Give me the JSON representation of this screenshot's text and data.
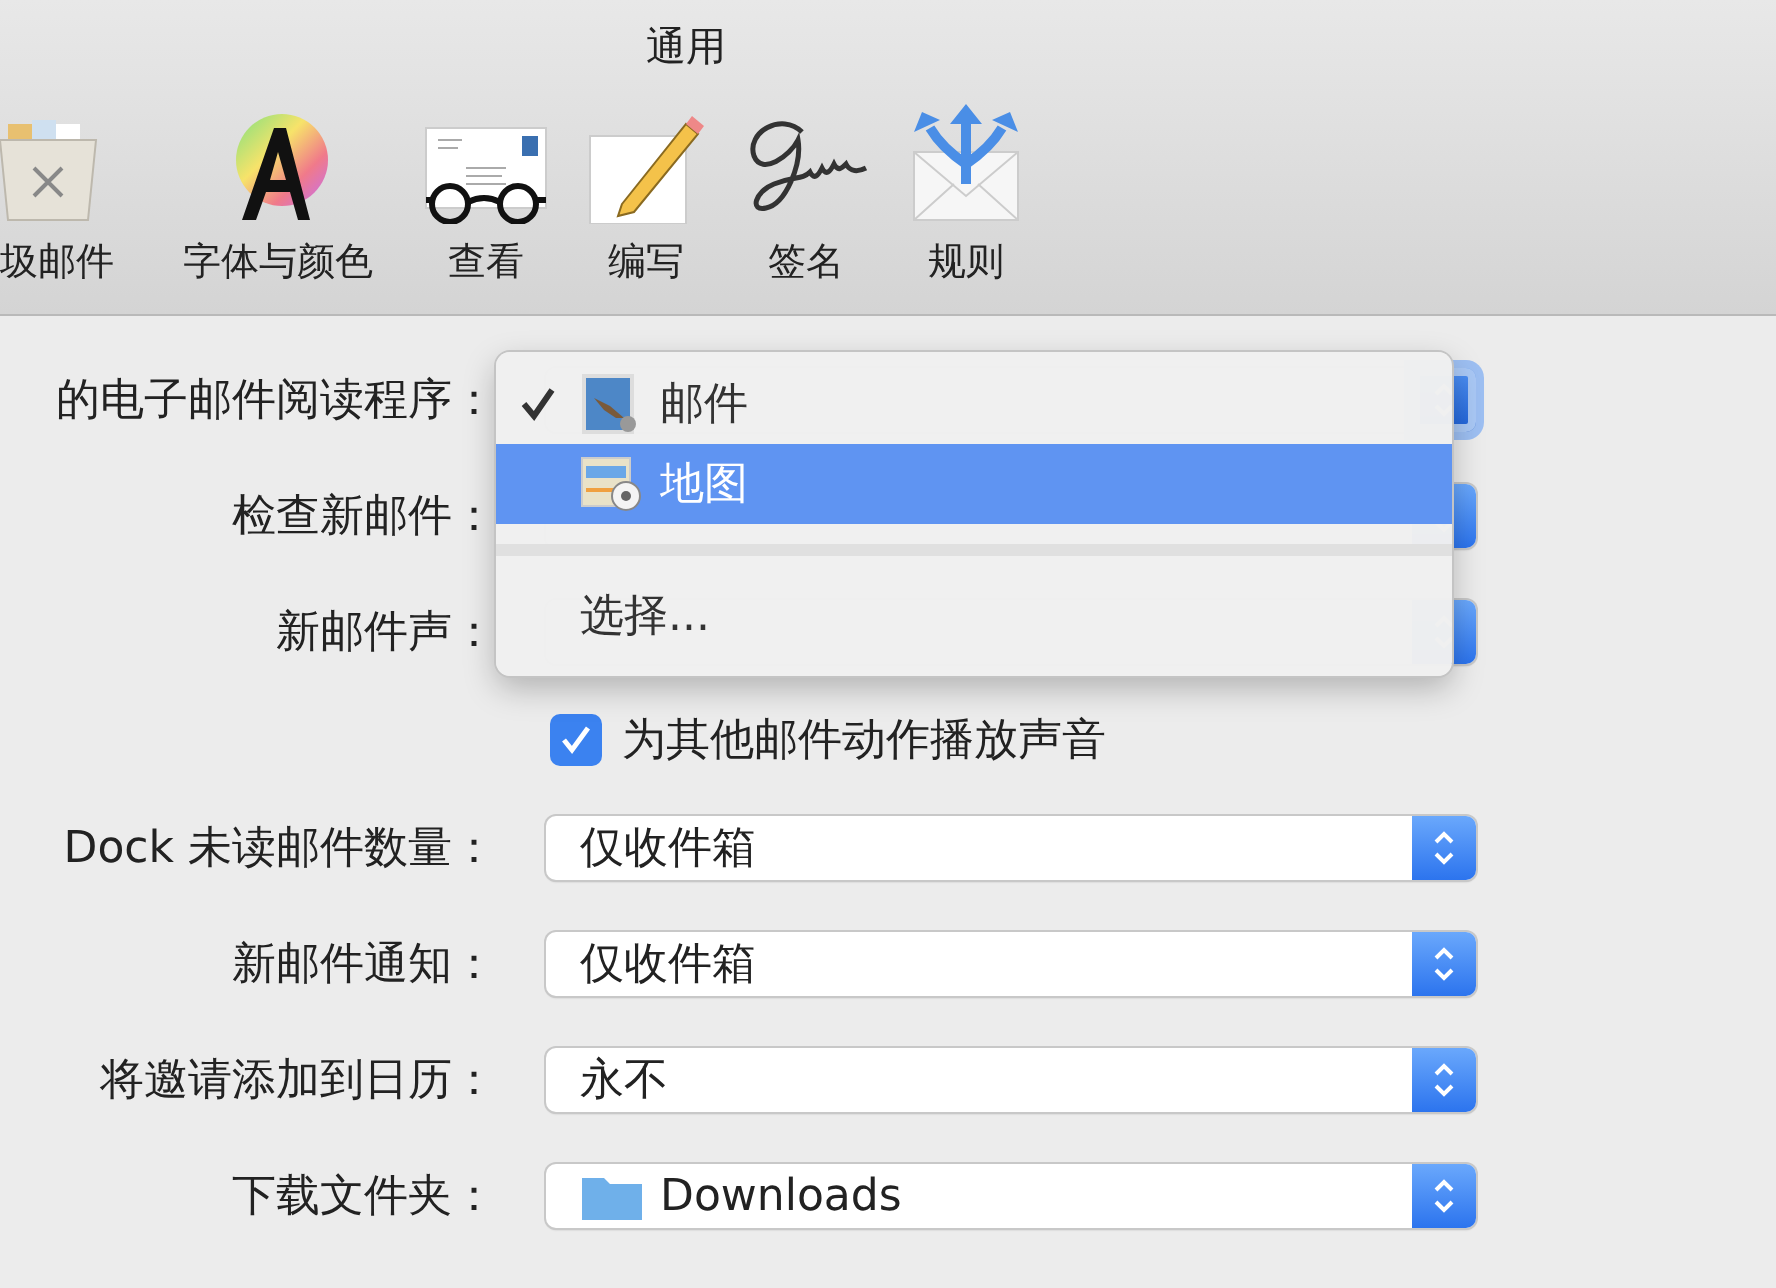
{
  "window": {
    "title": "通用"
  },
  "toolbar": [
    {
      "label": "圾邮件"
    },
    {
      "label": "字体与颜色"
    },
    {
      "label": "查看"
    },
    {
      "label": "编写"
    },
    {
      "label": "签名"
    },
    {
      "label": "规则"
    }
  ],
  "form": {
    "rows": [
      {
        "kind": "popup",
        "label": "的电子邮件阅读程序：",
        "focused": true
      },
      {
        "kind": "popup",
        "label": "检查新邮件：",
        "focused": false
      },
      {
        "kind": "popup",
        "label": "新邮件声：",
        "focused": false
      },
      {
        "kind": "checkbox",
        "label": "为其他邮件动作播放声音",
        "checked": true
      },
      {
        "kind": "popup",
        "label": "Dock 未读邮件数量：",
        "value": "仅收件箱",
        "focused": false
      },
      {
        "kind": "popup",
        "label": "新邮件通知：",
        "value": "仅收件箱",
        "focused": false
      },
      {
        "kind": "popup",
        "label": "将邀请添加到日历：",
        "value": "永不",
        "focused": false
      },
      {
        "kind": "folder",
        "label": "下载文件夹：",
        "value": "Downloads",
        "focused": false
      }
    ]
  },
  "menu": {
    "items": [
      {
        "kind": "app",
        "label": "邮件",
        "checked": true,
        "selected": false
      },
      {
        "kind": "app",
        "label": "地图",
        "checked": false,
        "selected": true
      },
      {
        "kind": "separator"
      },
      {
        "kind": "action",
        "label": "选择...",
        "selected": false
      }
    ]
  }
}
